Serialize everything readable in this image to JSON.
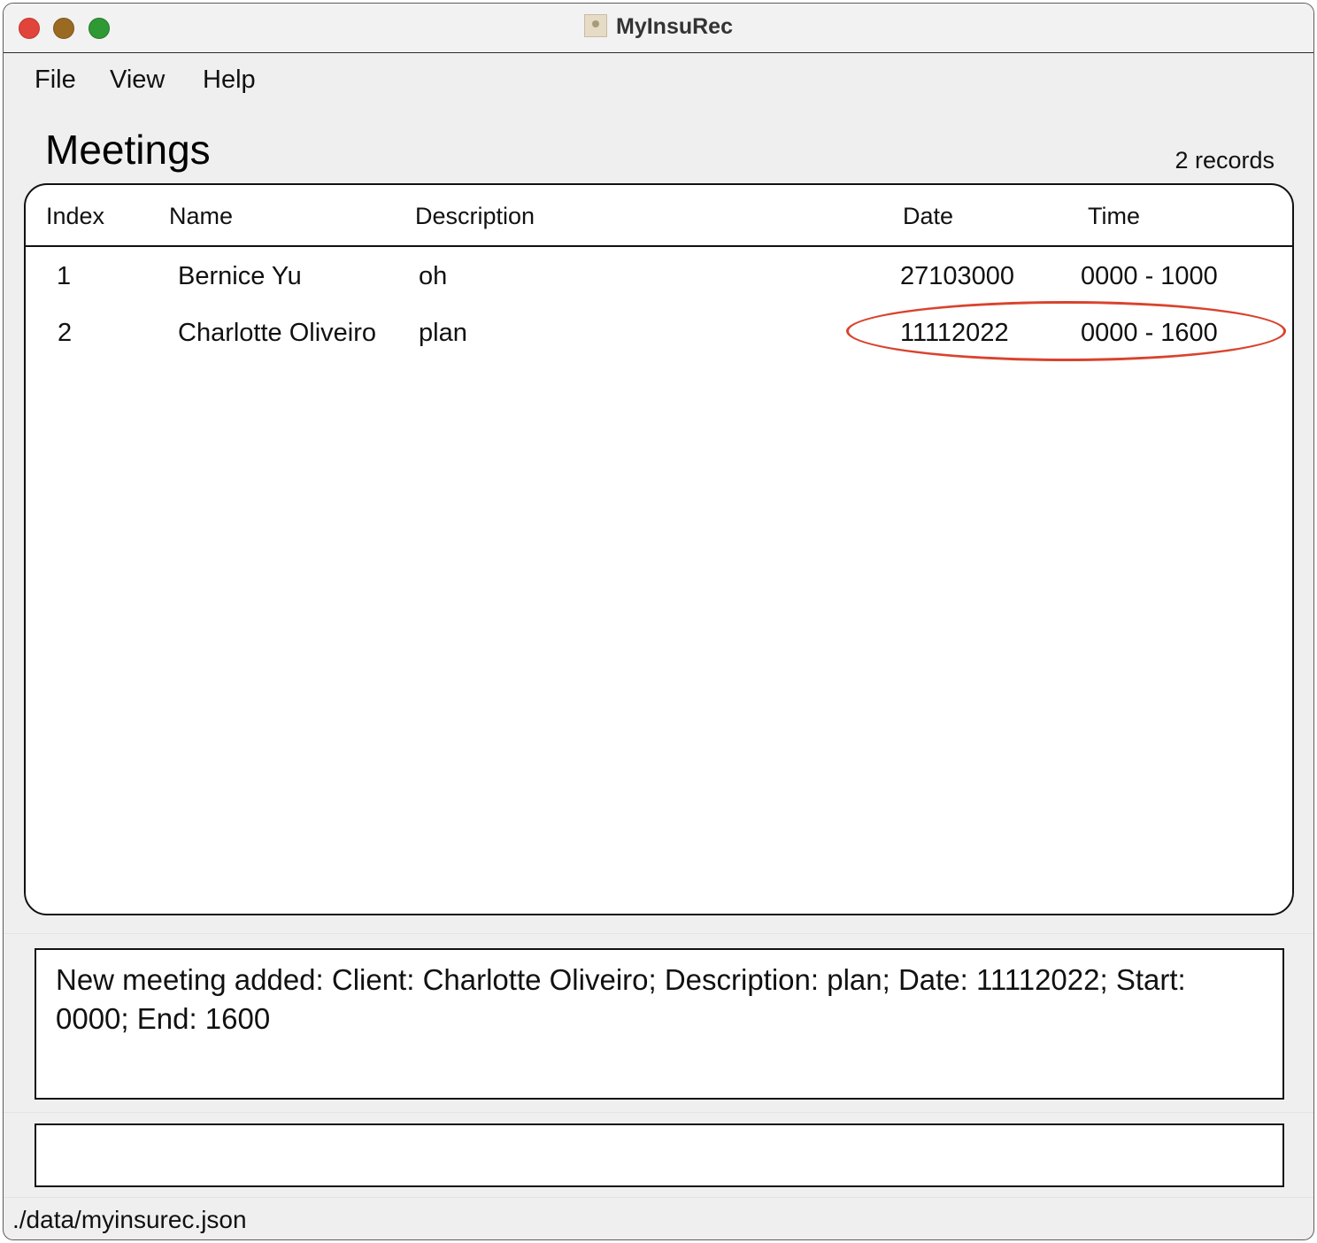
{
  "window": {
    "title": "MyInsuRec"
  },
  "menu": {
    "items": [
      "File",
      "View",
      "Help"
    ]
  },
  "section": {
    "title": "Meetings",
    "record_count": "2 records"
  },
  "table": {
    "columns": [
      "Index",
      "Name",
      "Description",
      "Date",
      "Time"
    ],
    "rows": [
      {
        "index": "1",
        "name": "Bernice Yu",
        "description": "oh",
        "date": "27103000",
        "time": "0000 - 1000"
      },
      {
        "index": "2",
        "name": "Charlotte Oliveiro",
        "description": "plan",
        "date": "11112022",
        "time": "0000 - 1600"
      }
    ]
  },
  "result": {
    "message": "New meeting added: Client: Charlotte Oliveiro; Description: plan; Date: 11112022; Start: 0000; End: 1600"
  },
  "command": {
    "value": ""
  },
  "status": {
    "file_path": "./data/myinsurec.json"
  },
  "colors": {
    "highlight": "#d9432e",
    "close": "#e0443a",
    "minimize": "#9a6a22",
    "zoom": "#2f9a34"
  }
}
